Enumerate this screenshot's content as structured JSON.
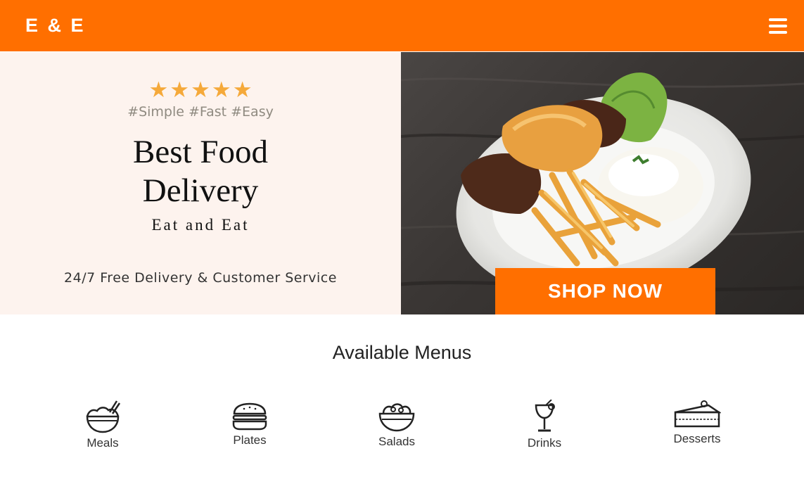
{
  "header": {
    "brand": "E & E",
    "menu_icon": "hamburger-menu-icon",
    "bg_color": "#ff6f00"
  },
  "hero": {
    "rating": 5,
    "rating_max": 5,
    "tagline": "#Simple #Fast #Easy",
    "title_line1": "Best Food",
    "title_line2": "Delivery",
    "subtitle": "Eat and Eat",
    "note": "24/7 Free Delivery & Customer Service",
    "cta_label": "SHOP NOW",
    "image_alt": "Plate with steak, rice, fries, egg and lettuce",
    "star_color": "#f5a93a",
    "left_bg": "#fdf3ee"
  },
  "menus": {
    "title": "Available Menus",
    "items": [
      {
        "label": "Meals",
        "icon": "rice-bowl-icon"
      },
      {
        "label": "Plates",
        "icon": "burger-icon"
      },
      {
        "label": "Salads",
        "icon": "salad-bowl-icon"
      },
      {
        "label": "Drinks",
        "icon": "cocktail-glass-icon"
      },
      {
        "label": "Desserts",
        "icon": "cake-slice-icon"
      }
    ]
  }
}
